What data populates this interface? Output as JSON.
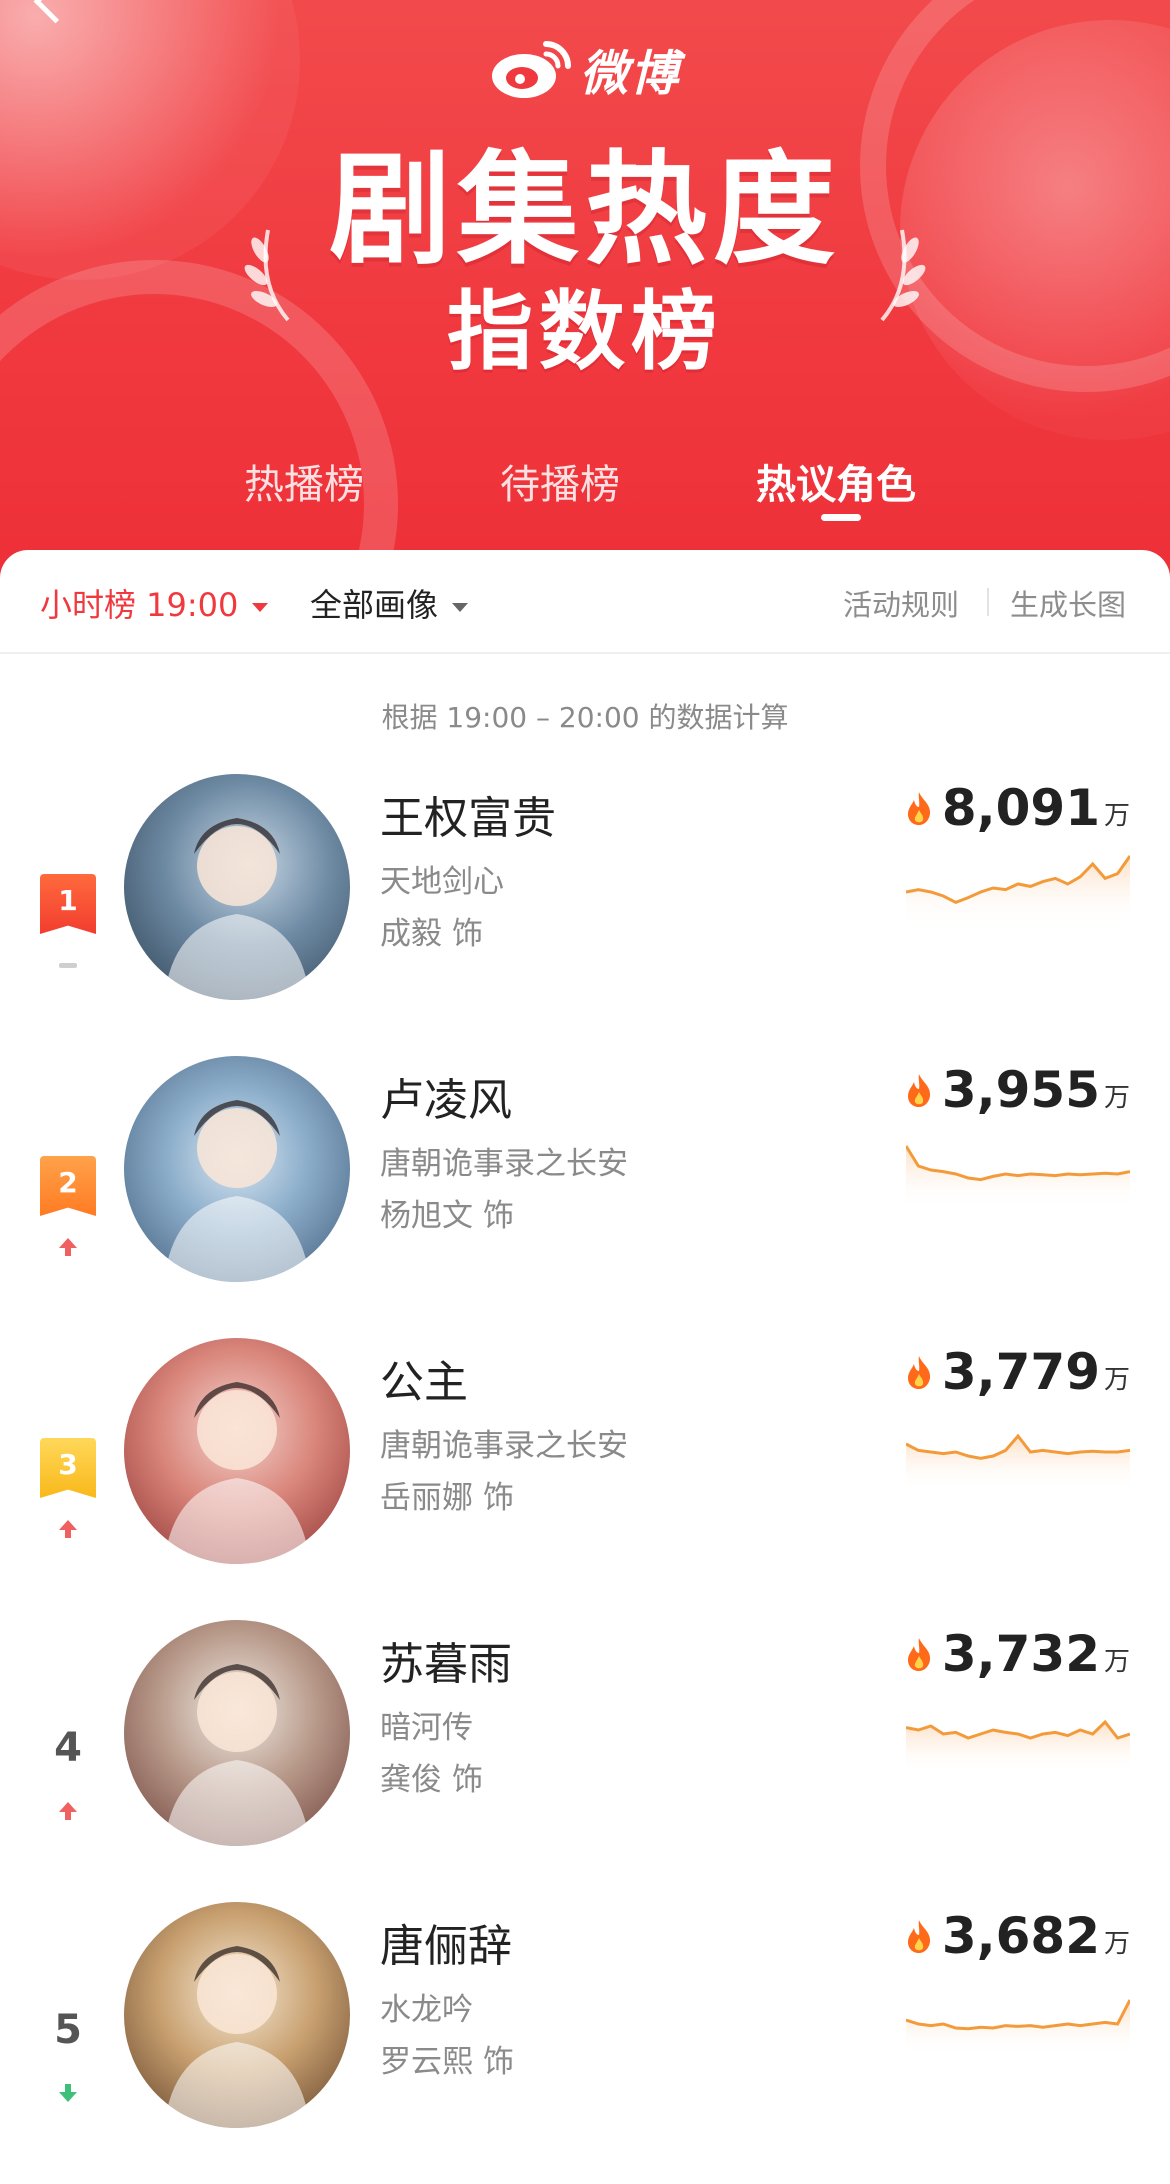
{
  "app": {
    "logo_text": "微博",
    "title": "剧集热度",
    "subtitle": "指数榜",
    "colors": {
      "brand": "#f0393f",
      "accent": "#f0393f",
      "flame": "#ff6a1a",
      "sparkline": "#f39a3a",
      "up": "#f06060",
      "down": "#3cc07a"
    }
  },
  "tabs": [
    {
      "label": "热播榜",
      "active": false
    },
    {
      "label": "待播榜",
      "active": false
    },
    {
      "label": "热议角色",
      "active": true
    }
  ],
  "filters": {
    "time_filter": "小时榜 19:00",
    "category_filter": "全部画像",
    "rules_link": "活动规则",
    "image_link": "生成长图"
  },
  "note": "根据 19:00 – 20:00 的数据计算",
  "ranking": [
    {
      "rank": "1",
      "name": "王权富贵",
      "drama": "天地剑心",
      "actor": "成毅",
      "role_suffix": "饰",
      "score": "8,091",
      "unit": "万",
      "trend": "same",
      "trend_icon": "dash-icon",
      "sparkline": [
        0.55,
        0.52,
        0.55,
        0.6,
        0.68,
        0.62,
        0.55,
        0.5,
        0.52,
        0.45,
        0.48,
        0.42,
        0.38,
        0.45,
        0.36,
        0.2,
        0.38,
        0.32,
        0.1
      ]
    },
    {
      "rank": "2",
      "name": "卢凌风",
      "drama": "唐朝诡事录之长安",
      "actor": "杨旭文",
      "role_suffix": "饰",
      "score": "3,955",
      "unit": "万",
      "trend": "up",
      "trend_icon": "arrow-up-icon",
      "sparkline": [
        0.2,
        0.45,
        0.5,
        0.52,
        0.55,
        0.6,
        0.62,
        0.58,
        0.55,
        0.57,
        0.55,
        0.56,
        0.57,
        0.55,
        0.56,
        0.55,
        0.54,
        0.55,
        0.52
      ]
    },
    {
      "rank": "3",
      "name": "公主",
      "drama": "唐朝诡事录之长安",
      "actor": "岳丽娜",
      "role_suffix": "饰",
      "score": "3,779",
      "unit": "万",
      "trend": "up",
      "trend_icon": "arrow-up-icon",
      "sparkline": [
        0.4,
        0.48,
        0.5,
        0.52,
        0.5,
        0.55,
        0.58,
        0.55,
        0.48,
        0.3,
        0.5,
        0.48,
        0.5,
        0.52,
        0.5,
        0.49,
        0.5,
        0.5,
        0.48
      ]
    },
    {
      "rank": "4",
      "name": "苏暮雨",
      "drama": "暗河传",
      "actor": "龚俊",
      "role_suffix": "饰",
      "score": "3,732",
      "unit": "万",
      "trend": "up",
      "trend_icon": "arrow-up-icon",
      "sparkline": [
        0.42,
        0.45,
        0.4,
        0.5,
        0.48,
        0.55,
        0.5,
        0.45,
        0.48,
        0.5,
        0.55,
        0.5,
        0.48,
        0.52,
        0.45,
        0.5,
        0.35,
        0.55,
        0.5
      ]
    },
    {
      "rank": "5",
      "name": "唐俪辞",
      "drama": "水龙吟",
      "actor": "罗云熙",
      "role_suffix": "饰",
      "score": "3,682",
      "unit": "万",
      "trend": "down",
      "trend_icon": "arrow-down-icon",
      "sparkline": [
        0.55,
        0.6,
        0.62,
        0.6,
        0.65,
        0.66,
        0.64,
        0.65,
        0.62,
        0.63,
        0.62,
        0.64,
        0.62,
        0.6,
        0.62,
        0.6,
        0.58,
        0.6,
        0.3
      ]
    }
  ]
}
